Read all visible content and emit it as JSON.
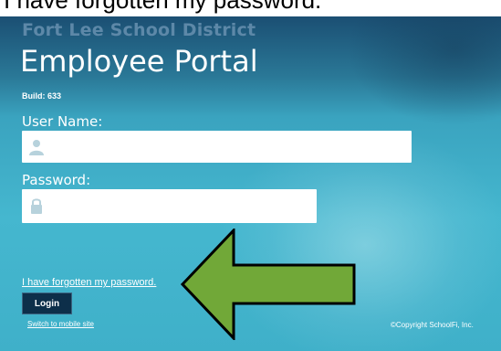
{
  "caption": {
    "text": "I have forgotten my password."
  },
  "header": {
    "district": "Fort Lee School District",
    "title": "Employee Portal",
    "build": "Build: 633"
  },
  "form": {
    "username_label": "User Name:",
    "username_value": "",
    "password_label": "Password:",
    "password_value": "",
    "user_icon": "user-icon",
    "lock_icon": "lock-icon"
  },
  "links": {
    "forgot_password": "I have forgotten my password.",
    "login_button": "Login",
    "switch_mobile": "Switch to mobile site"
  },
  "footer": {
    "copyright": "©Copyright SchoolFi, Inc."
  },
  "annotation": {
    "arrow_color": "#71a838",
    "arrow_outline": "#000000",
    "arrow_direction": "left"
  },
  "colors": {
    "district_text": "#5d88a8",
    "login_button_bg": "#0d2f4a"
  }
}
